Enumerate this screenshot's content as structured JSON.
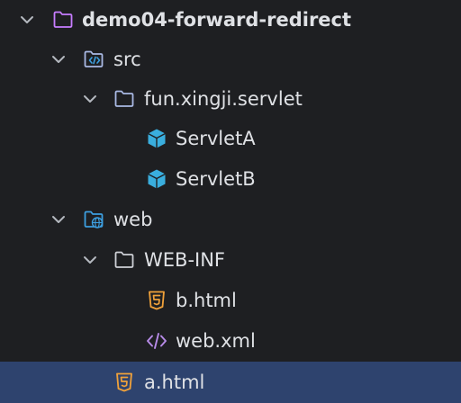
{
  "tree": {
    "items": [
      {
        "label": "demo04-forward-redirect",
        "icon": "module-folder-icon",
        "expanded": true
      },
      {
        "label": "src",
        "icon": "source-folder-icon",
        "expanded": true
      },
      {
        "label": "fun.xingji.servlet",
        "icon": "package-folder-icon",
        "expanded": true
      },
      {
        "label": "ServletA",
        "icon": "java-class-icon"
      },
      {
        "label": "ServletB",
        "icon": "java-class-icon"
      },
      {
        "label": "web",
        "icon": "web-folder-icon",
        "expanded": true
      },
      {
        "label": "WEB-INF",
        "icon": "folder-icon",
        "expanded": true
      },
      {
        "label": "b.html",
        "icon": "html5-icon"
      },
      {
        "label": "web.xml",
        "icon": "xml-icon"
      },
      {
        "label": "a.html",
        "icon": "html5-icon",
        "selected": true
      }
    ]
  },
  "colors": {
    "background": "#1e1f22",
    "text": "#dfe1e5",
    "selection": "#2e436e",
    "module_folder": "#c77dff",
    "folder": "#a9b9e4",
    "class_icon": "#3aaede",
    "html5": "#f0a13a",
    "xml": "#b78be8",
    "web_globe": "#3d9fe0"
  }
}
